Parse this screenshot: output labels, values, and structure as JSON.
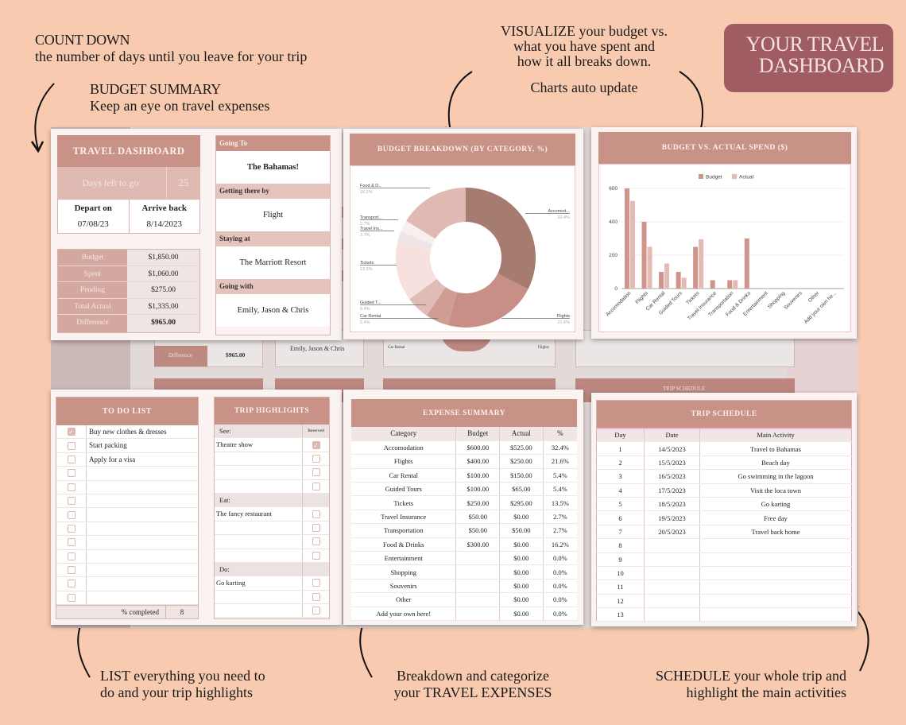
{
  "annotations": {
    "countdown": {
      "title": "COUNT DOWN",
      "text": "the number of days until you leave for your trip"
    },
    "budget_summary": {
      "title": "BUDGET SUMMARY",
      "text": "Keep an eye on travel expenses"
    },
    "visualize": {
      "line1": "VISUALIZE your budget vs.",
      "line2": "what you have spent and",
      "line3": "how it all breaks down.",
      "sub": "Charts auto update"
    },
    "list": {
      "line1": "LIST everything you need to",
      "line2": "do and your trip highlights"
    },
    "breakdown": {
      "line1": "Breakdown and categorize",
      "line2": "your TRAVEL EXPENSES"
    },
    "schedule": {
      "line1": "SCHEDULE your whole trip and",
      "line2": "highlight the main activities"
    }
  },
  "brand": {
    "line1": "YOUR TRAVEL",
    "line2": "DASHBOARD",
    "color": "#a05c63"
  },
  "colors": {
    "background": "#f8cbb0",
    "header": "#c99287"
  },
  "dashboard": {
    "title": "TRAVEL DASHBOARD",
    "days_left_label": "Days left to go:",
    "days_left_value": "25",
    "depart_label": "Depart on",
    "depart_value": "07/08/23",
    "arrive_label": "Arrive back",
    "arrive_value": "8/14/2023",
    "budget_rows": [
      {
        "label": "Budget",
        "value": "$1,850.00"
      },
      {
        "label": "Spent",
        "value": "$1,060.00"
      },
      {
        "label": "Pending",
        "value": "$275.00"
      },
      {
        "label": "Total Actual",
        "value": "$1,335.00"
      },
      {
        "label": "Difference",
        "value": "$965.00"
      }
    ],
    "trip_info": [
      {
        "label": "Going To",
        "value": "The Bahamas!"
      },
      {
        "label": "Getting there by",
        "value": "Flight"
      },
      {
        "label": "Staying at",
        "value": "The Marriott Resort"
      },
      {
        "label": "Going with",
        "value": "Emily, Jason & Chris"
      }
    ]
  },
  "background_copy": {
    "difference_label": "Difference",
    "difference_value": "$965.00",
    "going_with": "Emily, Jason & Chris",
    "car_rental": "Car Rental",
    "flights": "Flights",
    "trip_schedule": "TRIP SCHEDULE"
  },
  "chart_data": [
    {
      "type": "pie",
      "title": "BUDGET BREAKDOWN (BY CATEGORY, %)",
      "donut": true,
      "categories": [
        "Accomod...",
        "Flights",
        "Car Rental",
        "Guided T...",
        "Tickets",
        "Travel Ins...",
        "Transport...",
        "Food & D..."
      ],
      "values": [
        32.4,
        21.6,
        5.4,
        5.4,
        13.5,
        2.7,
        2.7,
        16.2
      ],
      "labels": [
        "32.4%",
        "21.6%",
        "5.4%",
        "5.4%",
        "13.5%",
        "2.7%",
        "2.7%",
        "16.2%"
      ],
      "colors": [
        "#a77c70",
        "#c88f86",
        "#d09d95",
        "#e1bcb6",
        "#f6e1de",
        "#ece6e6",
        "#f8f0ef",
        "#dfb9b2"
      ]
    },
    {
      "type": "bar",
      "title": "BUDGET VS. ACTUAL SPEND ($)",
      "categories": [
        "Accomodation",
        "Flights",
        "Car Rental",
        "Guided Tours",
        "Tickets",
        "Travel Insurance",
        "Transportation",
        "Food & Drinks",
        "Entertainment",
        "Shopping",
        "Souvenirs",
        "Other",
        "Add your own he..."
      ],
      "series": [
        {
          "name": "Budget",
          "color": "#cf958c",
          "values": [
            600,
            400,
            100,
            100,
            250,
            50,
            50,
            300,
            0,
            0,
            0,
            0,
            0
          ]
        },
        {
          "name": "Actual",
          "color": "#e3bab4",
          "values": [
            525,
            250,
            150,
            65,
            295,
            0,
            50,
            0,
            0,
            0,
            0,
            0,
            0
          ]
        }
      ],
      "yticks": [
        "0",
        "200",
        "400",
        "600"
      ],
      "ylim": [
        0,
        600
      ],
      "grid": true,
      "legend": "top"
    }
  ],
  "todo": {
    "title": "TO DO LIST",
    "items": [
      {
        "text": "Buy new clothes & dresses",
        "checked": true
      },
      {
        "text": "Start packing",
        "checked": false
      },
      {
        "text": "Apply for a visa",
        "checked": false
      },
      {
        "text": "",
        "checked": false
      },
      {
        "text": "",
        "checked": false
      },
      {
        "text": "",
        "checked": false
      },
      {
        "text": "",
        "checked": false
      },
      {
        "text": "",
        "checked": false
      },
      {
        "text": "",
        "checked": false
      },
      {
        "text": "",
        "checked": false
      },
      {
        "text": "",
        "checked": false
      },
      {
        "text": "",
        "checked": false
      },
      {
        "text": "",
        "checked": false
      }
    ],
    "footer_label": "% completed",
    "footer_value": "8"
  },
  "highlights": {
    "title": "TRIP HIGHLIGHTS",
    "reserved_label": "Reserved",
    "sections": [
      {
        "label": "See:",
        "items": [
          {
            "text": "Theatre show",
            "checked": true
          },
          {
            "text": "",
            "checked": false
          },
          {
            "text": "",
            "checked": false
          },
          {
            "text": "",
            "checked": false
          }
        ]
      },
      {
        "label": "Eat:",
        "items": [
          {
            "text": "The fancy restaurant",
            "checked": false
          },
          {
            "text": "",
            "checked": false
          },
          {
            "text": "",
            "checked": false
          },
          {
            "text": "",
            "checked": false
          }
        ]
      },
      {
        "label": "Do:",
        "items": [
          {
            "text": "Go karting",
            "checked": false
          },
          {
            "text": "",
            "checked": false
          },
          {
            "text": "",
            "checked": false
          }
        ]
      }
    ]
  },
  "expense": {
    "title": "EXPENSE SUMMARY",
    "columns": [
      "Category",
      "Budget",
      "Actual",
      "%"
    ],
    "rows": [
      [
        "Accomodation",
        "$600.00",
        "$525.00",
        "32.4%"
      ],
      [
        "Flights",
        "$400.00",
        "$250.00",
        "21.6%"
      ],
      [
        "Car Rental",
        "$100.00",
        "$150.00",
        "5.4%"
      ],
      [
        "Guided Tours",
        "$100.00",
        "$65.00",
        "5.4%"
      ],
      [
        "Tickets",
        "$250.00",
        "$295.00",
        "13.5%"
      ],
      [
        "Travel Insurance",
        "$50.00",
        "$0.00",
        "2.7%"
      ],
      [
        "Transportation",
        "$50.00",
        "$50.00",
        "2.7%"
      ],
      [
        "Food & Drinks",
        "$300.00",
        "$0.00",
        "16.2%"
      ],
      [
        "Entertainment",
        "",
        "$0.00",
        "0.0%"
      ],
      [
        "Shopping",
        "",
        "$0.00",
        "0.0%"
      ],
      [
        "Souvenirs",
        "",
        "$0.00",
        "0.0%"
      ],
      [
        "Other",
        "",
        "$0.00",
        "0.0%"
      ],
      [
        "Add your own here!",
        "",
        "$0.00",
        "0.0%"
      ]
    ]
  },
  "schedule": {
    "title": "TRIP SCHEDULE",
    "columns": [
      "Day",
      "Date",
      "Main Activity"
    ],
    "rows": [
      [
        "1",
        "14/5/2023",
        "Travel to Bahamas"
      ],
      [
        "2",
        "15/5/2023",
        "Beach day"
      ],
      [
        "3",
        "16/5/2023",
        "Go swimming in the lagoon"
      ],
      [
        "4",
        "17/5/2023",
        "Visit the loca town"
      ],
      [
        "5",
        "18/5/2023",
        "Go karting"
      ],
      [
        "6",
        "19/5/2023",
        "Free day"
      ],
      [
        "7",
        "20/5/2023",
        "Travel back home"
      ],
      [
        "8",
        "",
        ""
      ],
      [
        "9",
        "",
        ""
      ],
      [
        "10",
        "",
        ""
      ],
      [
        "11",
        "",
        ""
      ],
      [
        "12",
        "",
        ""
      ],
      [
        "13",
        "",
        ""
      ]
    ]
  }
}
